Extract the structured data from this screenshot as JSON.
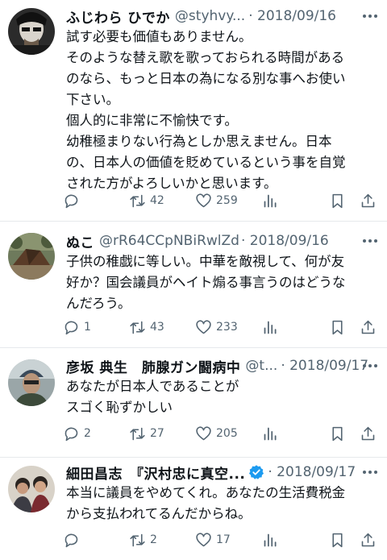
{
  "tweets": [
    {
      "name": "ふじわら ひでか",
      "handle": "@styhvy...",
      "date": "· 2018/09/16",
      "verified": false,
      "lines": [
        "試す必要も価値もありません。",
        "そのような替え歌を歌っておられる時間がある",
        "のなら、もっと日本の為になる別な事へお使い",
        "下さい。",
        "個人的に非常に不愉快です。",
        "幼稚極まりない行為としか思えません。日本",
        "の、日本人の価値を貶めているという事を自覚",
        "された方がよろしいかと思います。"
      ],
      "replies": "",
      "retweets": "42",
      "likes": "259"
    },
    {
      "name": "ぬこ",
      "handle": "@rR64CCpNBiRwlZd",
      "date": "· 2018/09/16",
      "verified": false,
      "lines": [
        "子供の稚戯に等しい。中華を敵視して、何が友",
        "好か？国会議員がヘイト煽る事言うのはどうな",
        "んだろう。"
      ],
      "replies": "1",
      "retweets": "43",
      "likes": "233"
    },
    {
      "name": "彦坂 典生　肺腺ガン闘病中",
      "handle": "@t...",
      "date": "· 2018/09/17",
      "verified": false,
      "lines": [
        "あなたが日本人であることが",
        "スゴく恥ずかしい"
      ],
      "replies": "2",
      "retweets": "27",
      "likes": "205"
    },
    {
      "name": "細田昌志　『沢村忠に真空...",
      "handle": "",
      "date": "· 2018/09/17",
      "verified": true,
      "lines": [
        "本当に議員をやめてくれ。あなたの生活費税金",
        "から支払われてるんだからね。"
      ],
      "replies": "",
      "retweets": "2",
      "likes": "17"
    }
  ],
  "icons": {
    "reply": "reply-icon",
    "retweet": "retweet-icon",
    "like": "heart-icon",
    "views": "views-icon",
    "bookmark": "bookmark-icon",
    "share": "share-icon",
    "more": "more-icon",
    "verified": "verified-badge-icon"
  },
  "colors": {
    "text": "#0f1419",
    "muted": "#536471",
    "verified": "#1d9bf0"
  }
}
